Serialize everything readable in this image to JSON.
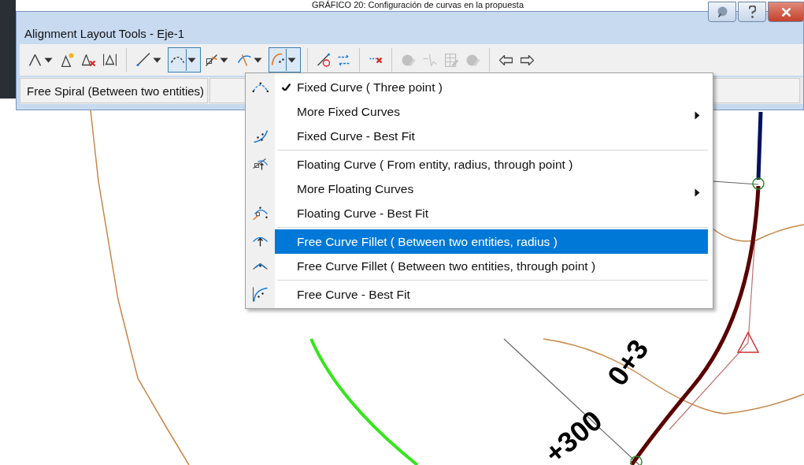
{
  "caption": "GRÁFICO 20: Configuración de curvas en la propuesta",
  "window": {
    "title": "Alignment Layout Tools - Eje-1",
    "buttons": [
      {
        "kind": "bubble"
      },
      {
        "kind": "help"
      },
      {
        "kind": "close"
      }
    ]
  },
  "toolbar": [
    {
      "kind": "pi",
      "dropdown": true,
      "selected": false,
      "disabled": false
    },
    {
      "kind": "insert-pi",
      "dropdown": false,
      "selected": false,
      "disabled": false
    },
    {
      "kind": "delete-pi",
      "dropdown": false,
      "selected": false,
      "disabled": false
    },
    {
      "kind": "break-pi",
      "dropdown": false,
      "selected": false,
      "disabled": false,
      "divider": true
    },
    {
      "kind": "line",
      "dropdown": true,
      "selected": false,
      "disabled": false
    },
    {
      "kind": "curve",
      "dropdown": true,
      "selected": true,
      "disabled": false
    },
    {
      "kind": "float-line",
      "dropdown": true,
      "selected": false,
      "disabled": false
    },
    {
      "kind": "spiral",
      "dropdown": true,
      "selected": false,
      "disabled": false
    },
    {
      "kind": "fillet",
      "dropdown": true,
      "selected": true,
      "disabled": false,
      "divider": true
    },
    {
      "kind": "convert",
      "dropdown": false,
      "selected": false,
      "disabled": false
    },
    {
      "kind": "reverse",
      "dropdown": false,
      "selected": false,
      "disabled": false,
      "divider": true
    },
    {
      "kind": "delete",
      "dropdown": false,
      "selected": false,
      "disabled": false,
      "divider": true
    },
    {
      "kind": "edit",
      "dropdown": false,
      "selected": false,
      "disabled": true
    },
    {
      "kind": "pick",
      "dropdown": false,
      "selected": false,
      "disabled": true
    },
    {
      "kind": "grid",
      "dropdown": false,
      "selected": false,
      "disabled": true
    },
    {
      "kind": "edit",
      "dropdown": false,
      "selected": false,
      "disabled": true,
      "divider": true
    },
    {
      "kind": "undo",
      "dropdown": false,
      "selected": false,
      "disabled": false
    },
    {
      "kind": "redo",
      "dropdown": false,
      "selected": false,
      "disabled": false
    }
  ],
  "status": {
    "current_command": "Free Spiral (Between two entities)"
  },
  "menu": [
    [
      {
        "kind": "three-point",
        "label": "Fixed Curve ( Three point )",
        "checked": true,
        "selected": false,
        "submenu": false
      },
      {
        "kind": "none",
        "label": "More Fixed Curves",
        "checked": false,
        "selected": false,
        "submenu": true
      },
      {
        "kind": "best-fit",
        "label": "Fixed Curve - Best Fit",
        "checked": false,
        "selected": false,
        "submenu": false
      }
    ],
    [
      {
        "kind": "floating",
        "label": "Floating Curve ( From entity, radius, through point )",
        "checked": false,
        "selected": false,
        "submenu": false
      },
      {
        "kind": "none",
        "label": "More Floating Curves",
        "checked": false,
        "selected": false,
        "submenu": true
      },
      {
        "kind": "floating-fit",
        "label": "Floating Curve - Best Fit",
        "checked": false,
        "selected": false,
        "submenu": false
      }
    ],
    [
      {
        "kind": "fillet-radius",
        "label": "Free Curve Fillet ( Between two entities, radius )",
        "checked": false,
        "selected": true,
        "submenu": false
      },
      {
        "kind": "fillet-point",
        "label": "Free Curve Fillet ( Between two entities, through point )",
        "checked": false,
        "selected": false,
        "submenu": false
      }
    ],
    [
      {
        "kind": "free-fit",
        "label": "Free Curve - Best Fit",
        "checked": false,
        "selected": false,
        "submenu": false
      }
    ]
  ],
  "drawing": {
    "station_labels": [
      "0+3",
      "+300"
    ]
  }
}
